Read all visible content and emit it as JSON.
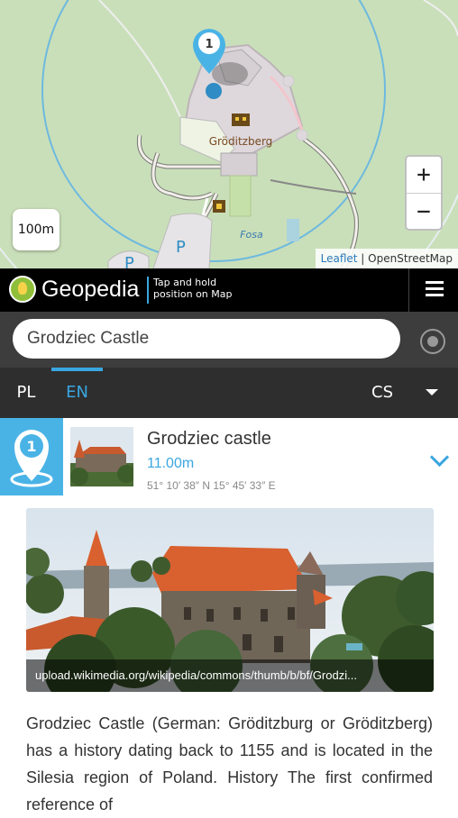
{
  "map": {
    "castle_label": "Gröditzberg",
    "water_label": "Fosa",
    "parking_label": "P",
    "scale_label": "100m",
    "zoom_in": "+",
    "zoom_out": "−",
    "attribution_leaflet": "Leaflet",
    "attribution_sep": " | ",
    "attribution_osm": "OpenStreetMap",
    "marker_number": "1"
  },
  "topbar": {
    "app_name": "Geopedia",
    "hint_line1": "Tap and hold",
    "hint_line2": "position on Map"
  },
  "search": {
    "value": "Grodziec Castle"
  },
  "languages": {
    "items": [
      "PL",
      "EN",
      "CS"
    ],
    "active": "EN"
  },
  "result": {
    "number": "1",
    "title": "Grodziec castle",
    "distance": "11.00m",
    "coordinates": "51° 10′ 38″ N 15° 45′ 33″ E"
  },
  "photo": {
    "caption": "upload.wikimedia.org/wikipedia/commons/thumb/b/bf/Grodzi..."
  },
  "description": "Grodziec Castle (German: Gröditzburg or Gröditzberg) has a history dating back to 1155 and is located in the Silesia region of Poland. History The first confirmed reference of",
  "colors": {
    "accent": "#3aa6e0",
    "map_background": "#c9dfb9",
    "topbar": "#000000",
    "searchbar": "#3d3d3d",
    "langbar": "#2e2e2e"
  }
}
